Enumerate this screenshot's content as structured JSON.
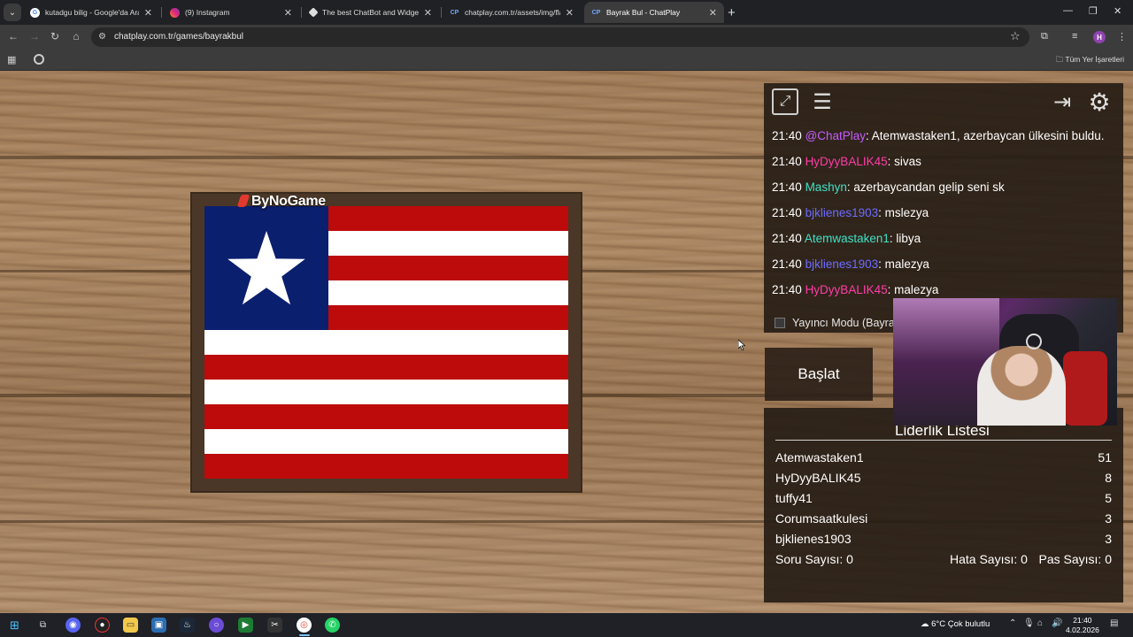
{
  "browser": {
    "tabs": [
      {
        "label": "kutadgu bilig - Google'da Ara",
        "icon": "google-icon",
        "active": false
      },
      {
        "label": "(9) Instagram",
        "icon": "instagram-icon",
        "active": false
      },
      {
        "label": "The best ChatBot and Widgets",
        "icon": "streamelements-icon",
        "active": false
      },
      {
        "label": "chatplay.com.tr/assets/img/flag",
        "icon": "chatplay-icon",
        "active": false
      },
      {
        "label": "Bayrak Bul - ChatPlay",
        "icon": "chatplay-icon",
        "active": true
      }
    ],
    "url": "chatplay.com.tr/games/bayrakbul",
    "bookmarks_all": "Tüm Yer İşaretleri",
    "profile_initial": "H"
  },
  "game": {
    "brand": "ByNoGame",
    "flag_colors": {
      "red": "#bd0a0a",
      "white": "#ffffff",
      "blue": "#0a1f6e"
    }
  },
  "chat": {
    "messages": [
      {
        "time": "21:40",
        "user": "@ChatPlay",
        "user_color": "#c45cff",
        "text": ": Atemwastaken1, azerbaycan ülkesini buldu."
      },
      {
        "time": "21:40",
        "user": "HyDyyBALIK45",
        "user_color": "#ff3da8",
        "text": ": sivas"
      },
      {
        "time": "21:40",
        "user": "Mashyn",
        "user_color": "#3fe0c5",
        "text": ": azerbaycandan gelip seni sk"
      },
      {
        "time": "21:40",
        "user": "bjklienes1903",
        "user_color": "#6b6bff",
        "text": ": mslezya"
      },
      {
        "time": "21:40",
        "user": "Atemwastaken1",
        "user_color": "#3fe0c5",
        "text": ": libya"
      },
      {
        "time": "21:40",
        "user": "bjklienes1903",
        "user_color": "#6b6bff",
        "text": ": malezya"
      },
      {
        "time": "21:40",
        "user": "HyDyyBALIK45",
        "user_color": "#ff3da8",
        "text": ": malezya"
      }
    ],
    "streamer_mode_label": "Yayıncı Modu (Bayra"
  },
  "controls": {
    "start_label": "Başlat"
  },
  "leaderboard": {
    "title": "Liderlik Listesi",
    "rows": [
      {
        "name": "Atemwastaken1",
        "score": "51"
      },
      {
        "name": "HyDyyBALIK45",
        "score": "8"
      },
      {
        "name": "tuffy41",
        "score": "5"
      },
      {
        "name": "Corumsaatkulesi",
        "score": "3"
      },
      {
        "name": "bjklienes1903",
        "score": "3"
      }
    ],
    "question_count": "Soru Sayısı: 0",
    "error_count": "Hata Sayısı: 0",
    "pass_count": "Pas Sayısı: 0"
  },
  "taskbar": {
    "weather": "6°C  Çok bulutlu",
    "time": "21:40",
    "date": "4.02.2026"
  }
}
